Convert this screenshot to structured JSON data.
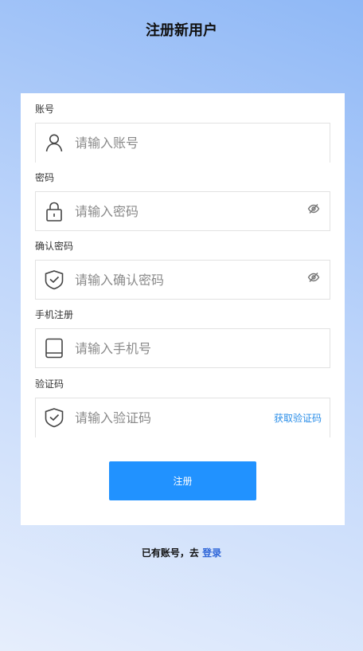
{
  "header": {
    "title": "注册新用户"
  },
  "form": {
    "account": {
      "label": "账号",
      "placeholder": "请输入账号",
      "icon": "user-icon"
    },
    "password": {
      "label": "密码",
      "placeholder": "请输入密码",
      "icon": "lock-icon",
      "toggle_icon": "eye-off-icon"
    },
    "confirm_password": {
      "label": "确认密码",
      "placeholder": "请输入确认密码",
      "icon": "shield-check-icon",
      "toggle_icon": "eye-off-icon"
    },
    "phone": {
      "label": "手机注册",
      "placeholder": "请输入手机号",
      "icon": "phone-icon"
    },
    "code": {
      "label": "验证码",
      "placeholder": "请输入验证码",
      "icon": "shield-check-icon",
      "get_code_label": "获取验证码"
    },
    "submit_label": "注册"
  },
  "footer": {
    "prompt": "已有账号，去 ",
    "login_label": "登录"
  },
  "colors": {
    "accent": "#2192ff",
    "link": "#2a8ee8",
    "login_link": "#2f66d8",
    "card": "#ffffff"
  }
}
